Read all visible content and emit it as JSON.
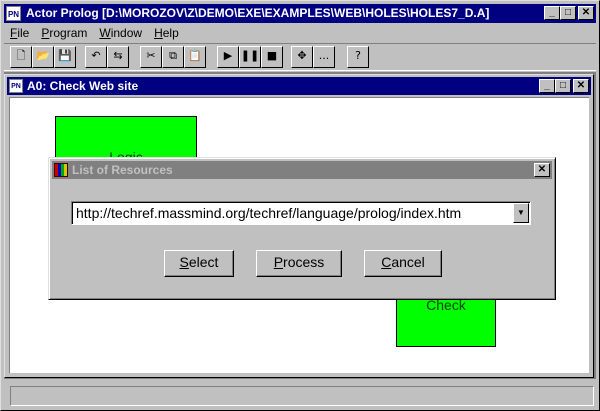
{
  "app": {
    "icon_text": "PN",
    "title": "Actor Prolog [D:\\MOROZOV\\Z\\DEMO\\EXE\\EXAMPLES\\WEB\\HOLES\\HOLES7_D.A]"
  },
  "caption_buttons": {
    "minimize": "_",
    "maximize": "□",
    "close": "✕"
  },
  "menu": [
    {
      "mnemonic": "F",
      "rest": "ile"
    },
    {
      "mnemonic": "P",
      "rest": "rogram"
    },
    {
      "mnemonic": "W",
      "rest": "indow"
    },
    {
      "mnemonic": "H",
      "rest": "elp"
    }
  ],
  "toolbar": {
    "groups": [
      [
        {
          "icon": "new-file-icon",
          "glyph": "🗋"
        },
        {
          "icon": "open-file-icon",
          "glyph": "📂"
        },
        {
          "icon": "save-icon",
          "glyph": "💾"
        }
      ],
      [
        {
          "icon": "undo-icon",
          "glyph": "↶"
        },
        {
          "icon": "redo-icon",
          "glyph": "⇆"
        }
      ],
      [
        {
          "icon": "cut-icon",
          "glyph": "✂"
        },
        {
          "icon": "copy-icon",
          "glyph": "⧉"
        },
        {
          "icon": "paste-icon",
          "glyph": "📋"
        }
      ],
      [
        {
          "icon": "run-icon",
          "glyph": "▶"
        },
        {
          "icon": "pause-icon",
          "glyph": "❚❚"
        },
        {
          "icon": "stop-icon",
          "glyph": "■"
        }
      ],
      [
        {
          "icon": "move-icon",
          "glyph": "✥"
        },
        {
          "icon": "more-icon",
          "glyph": "..."
        }
      ],
      [
        {
          "icon": "help-icon",
          "glyph": "?"
        }
      ]
    ]
  },
  "child_window": {
    "icon_text": "PN",
    "title": "A0: Check Web site"
  },
  "canvas": {
    "box_logic_label": "Logic",
    "box_check_label": "Check",
    "box_color": "#00ff00"
  },
  "dialog": {
    "title": "List of Resources",
    "combo_value": "http://techref.massmind.org/techref/language/prolog/index.htm",
    "buttons": {
      "select": {
        "mnemonic": "S",
        "rest": "elect"
      },
      "process": {
        "mnemonic": "P",
        "rest": "rocess"
      },
      "cancel": {
        "mnemonic": "C",
        "rest": "ancel"
      }
    }
  },
  "colors": {
    "title_active": "#000080",
    "title_inactive": "#808080",
    "face": "#c0c0c0",
    "workspace": "#808080"
  }
}
